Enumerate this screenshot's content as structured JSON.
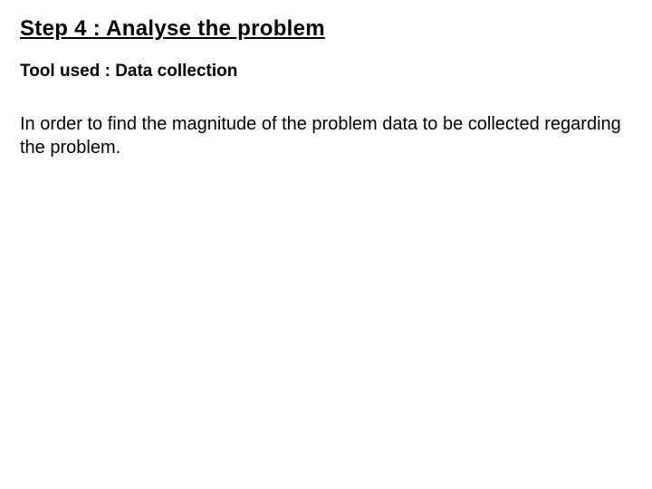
{
  "heading": "Step 4 :  Analyse the problem",
  "subheading": "Tool used : Data collection",
  "body": "In order to find the magnitude of the problem data to be collected regarding the problem."
}
